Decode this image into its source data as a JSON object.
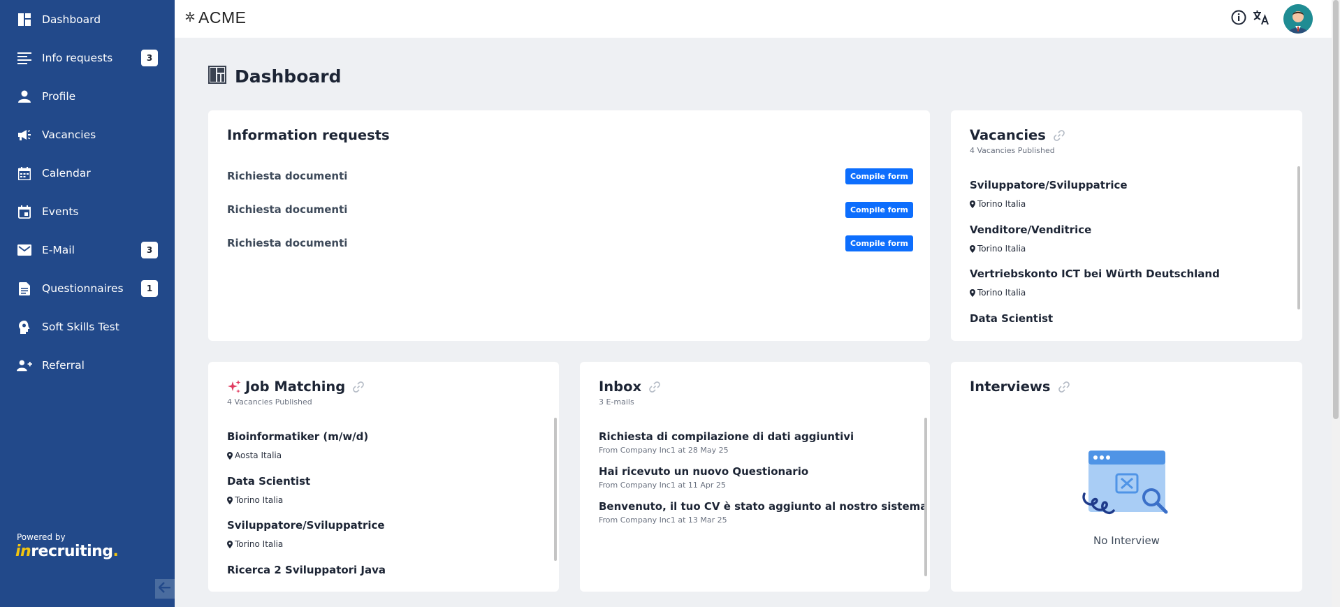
{
  "sidebar": {
    "items": [
      {
        "label": "Dashboard",
        "icon": "dashboard-icon",
        "badge": null
      },
      {
        "label": "Info requests",
        "icon": "list-icon",
        "badge": "3"
      },
      {
        "label": "Profile",
        "icon": "person-icon",
        "badge": null
      },
      {
        "label": "Vacancies",
        "icon": "megaphone-icon",
        "badge": null
      },
      {
        "label": "Calendar",
        "icon": "calendar-icon",
        "badge": null
      },
      {
        "label": "Events",
        "icon": "event-icon",
        "badge": null
      },
      {
        "label": "E-Mail",
        "icon": "mail-icon",
        "badge": "3"
      },
      {
        "label": "Questionnaires",
        "icon": "document-icon",
        "badge": "1"
      },
      {
        "label": "Soft Skills Test",
        "icon": "brain-icon",
        "badge": null
      },
      {
        "label": "Referral",
        "icon": "add-user-icon",
        "badge": null
      }
    ],
    "powered_by": "Powered by",
    "brand_prefix": "in",
    "brand_main": "recruiting",
    "brand_dot": "."
  },
  "topbar": {
    "company": "ACME"
  },
  "page": {
    "title": "Dashboard"
  },
  "info_requests": {
    "title": "Information requests",
    "items": [
      {
        "label": "Richiesta documenti",
        "button": "Compile form"
      },
      {
        "label": "Richiesta documenti",
        "button": "Compile form"
      },
      {
        "label": "Richiesta documenti",
        "button": "Compile form"
      }
    ]
  },
  "vacancies": {
    "title": "Vacancies",
    "subtitle": "4 Vacancies Published",
    "items": [
      {
        "title": "Sviluppatore/Sviluppatrice",
        "location": "Torino Italia"
      },
      {
        "title": "Venditore/Venditrice",
        "location": "Torino Italia"
      },
      {
        "title": "Vertriebskonto ICT bei Würth Deutschland",
        "location": "Torino Italia"
      },
      {
        "title": "Data Scientist",
        "location": ""
      }
    ]
  },
  "job_matching": {
    "title": "Job Matching",
    "subtitle": "4 Vacancies Published",
    "items": [
      {
        "title": "Bioinformatiker (m/w/d)",
        "location": "Aosta Italia"
      },
      {
        "title": "Data Scientist",
        "location": "Torino Italia"
      },
      {
        "title": "Sviluppatore/Sviluppatrice",
        "location": "Torino Italia"
      },
      {
        "title": "Ricerca 2 Sviluppatori Java",
        "location": ""
      }
    ]
  },
  "inbox": {
    "title": "Inbox",
    "subtitle": "3 E-mails",
    "items": [
      {
        "subject": "Richiesta di compilazione di dati aggiuntivi",
        "from": "From Company Inc1 at 28 May 25"
      },
      {
        "subject": "Hai ricevuto un nuovo Questionario",
        "from": "From Company Inc1 at 11 Apr 25"
      },
      {
        "subject": "Benvenuto, il tuo CV è stato aggiunto al nostro sistema",
        "from": "From Company Inc1 at 13 Mar 25"
      }
    ]
  },
  "interviews": {
    "title": "Interviews",
    "empty_text": "No Interview"
  },
  "colors": {
    "sidebar_bg": "#22498a",
    "accent": "#0d6efd",
    "sparkle": "#e03a5f"
  }
}
